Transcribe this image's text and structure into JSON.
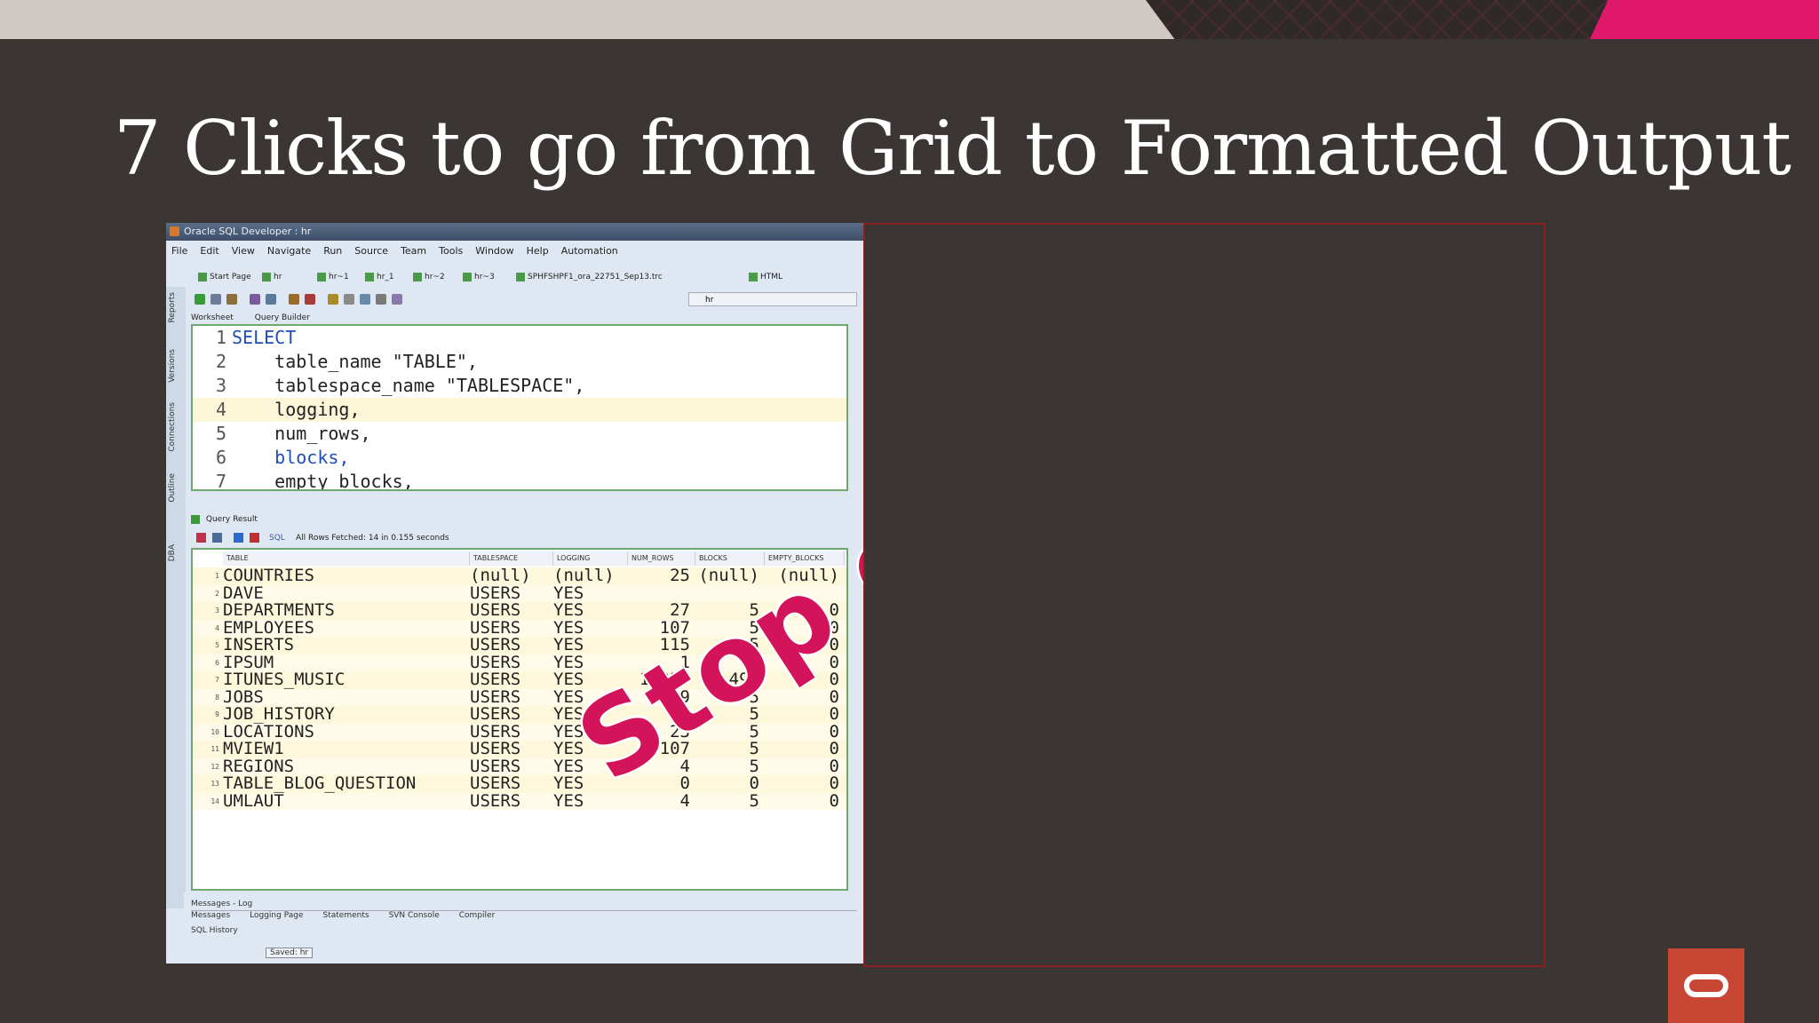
{
  "slide": {
    "title": "7 Clicks to go from Grid to Formatted Output",
    "stamp_text": "Stop doin",
    "colors": {
      "background": "#3b3533",
      "accent_pink": "#e0186c",
      "oracle_red": "#c74634",
      "panel_border": "#8b1e1e"
    },
    "logo_icon": "oracle-logo-icon"
  },
  "app": {
    "title": "Oracle SQL Developer : hr",
    "menu": [
      "File",
      "Edit",
      "View",
      "Navigate",
      "Run",
      "Source",
      "Team",
      "Tools",
      "Window",
      "Help",
      "Automation"
    ],
    "doc_tabs": [
      "Start Page",
      "hr",
      "hr~1",
      "hr_1",
      "hr~2",
      "hr~3",
      "SPHFSHPF1_ora_22751_Sep13.trc",
      "HTML"
    ],
    "connection": "hr",
    "sidebar_labels": [
      "Reports",
      "Versions",
      "Connections",
      "Outline",
      "DBA"
    ],
    "worksheet_tabs": [
      "Worksheet",
      "Query Builder"
    ],
    "editor_lines": [
      {
        "num": "1",
        "text": "SELECT",
        "kw": true,
        "hl": false
      },
      {
        "num": "2",
        "text": "    table_name \"TABLE\",",
        "kw": false,
        "hl": false
      },
      {
        "num": "3",
        "text": "    tablespace_name \"TABLESPACE\",",
        "kw": false,
        "hl": false
      },
      {
        "num": "4",
        "text": "    logging,",
        "kw": false,
        "hl": true
      },
      {
        "num": "5",
        "text": "    num_rows,",
        "kw": false,
        "hl": false
      },
      {
        "num": "6",
        "text": "    blocks,",
        "kw": true,
        "hl": false
      },
      {
        "num": "7",
        "text": "    empty_blocks,",
        "kw": false,
        "hl": false
      }
    ],
    "results_tab": "Query Result",
    "results_sql_label": "SQL",
    "fetched_text": "All Rows Fetched: 14 in 0.155 seconds",
    "columns": [
      "TABLE",
      "TABLESPACE",
      "LOGGING",
      "NUM_ROWS",
      "BLOCKS",
      "EMPTY_BLOCKS"
    ],
    "rows": [
      [
        "1",
        "COUNTRIES",
        "(null)",
        "(null)",
        "25",
        "(null)",
        "(null)"
      ],
      [
        "2",
        "DAVE",
        "USERS",
        "YES",
        "",
        "",
        ""
      ],
      [
        "3",
        "DEPARTMENTS",
        "USERS",
        "YES",
        "27",
        "5",
        "0"
      ],
      [
        "4",
        "EMPLOYEES",
        "USERS",
        "YES",
        "107",
        "5",
        "0"
      ],
      [
        "5",
        "INSERTS",
        "USERS",
        "YES",
        "115",
        "5",
        "0"
      ],
      [
        "6",
        "IPSUM",
        "USERS",
        "YES",
        "1",
        "5",
        "0"
      ],
      [
        "7",
        "ITUNES_MUSIC",
        "USERS",
        "YES",
        "10229",
        "496",
        "0"
      ],
      [
        "8",
        "JOBS",
        "USERS",
        "YES",
        "19",
        "5",
        "0"
      ],
      [
        "9",
        "JOB_HISTORY",
        "USERS",
        "YES",
        "10",
        "5",
        "0"
      ],
      [
        "10",
        "LOCATIONS",
        "USERS",
        "YES",
        "23",
        "5",
        "0"
      ],
      [
        "11",
        "MVIEW1",
        "USERS",
        "YES",
        "107",
        "5",
        "0"
      ],
      [
        "12",
        "REGIONS",
        "USERS",
        "YES",
        "4",
        "5",
        "0"
      ],
      [
        "13",
        "TABLE_BLOG_QUESTION",
        "USERS",
        "YES",
        "0",
        "0",
        "0"
      ],
      [
        "14",
        "UMLAUT",
        "USERS",
        "YES",
        "4",
        "5",
        "0"
      ]
    ],
    "messages_title": "Messages - Log",
    "bottom_tabs": [
      "Messages",
      "Logging Page",
      "Statements",
      "SVN Console",
      "Compiler"
    ],
    "history_label": "SQL History",
    "saved_label": "Saved: hr"
  }
}
